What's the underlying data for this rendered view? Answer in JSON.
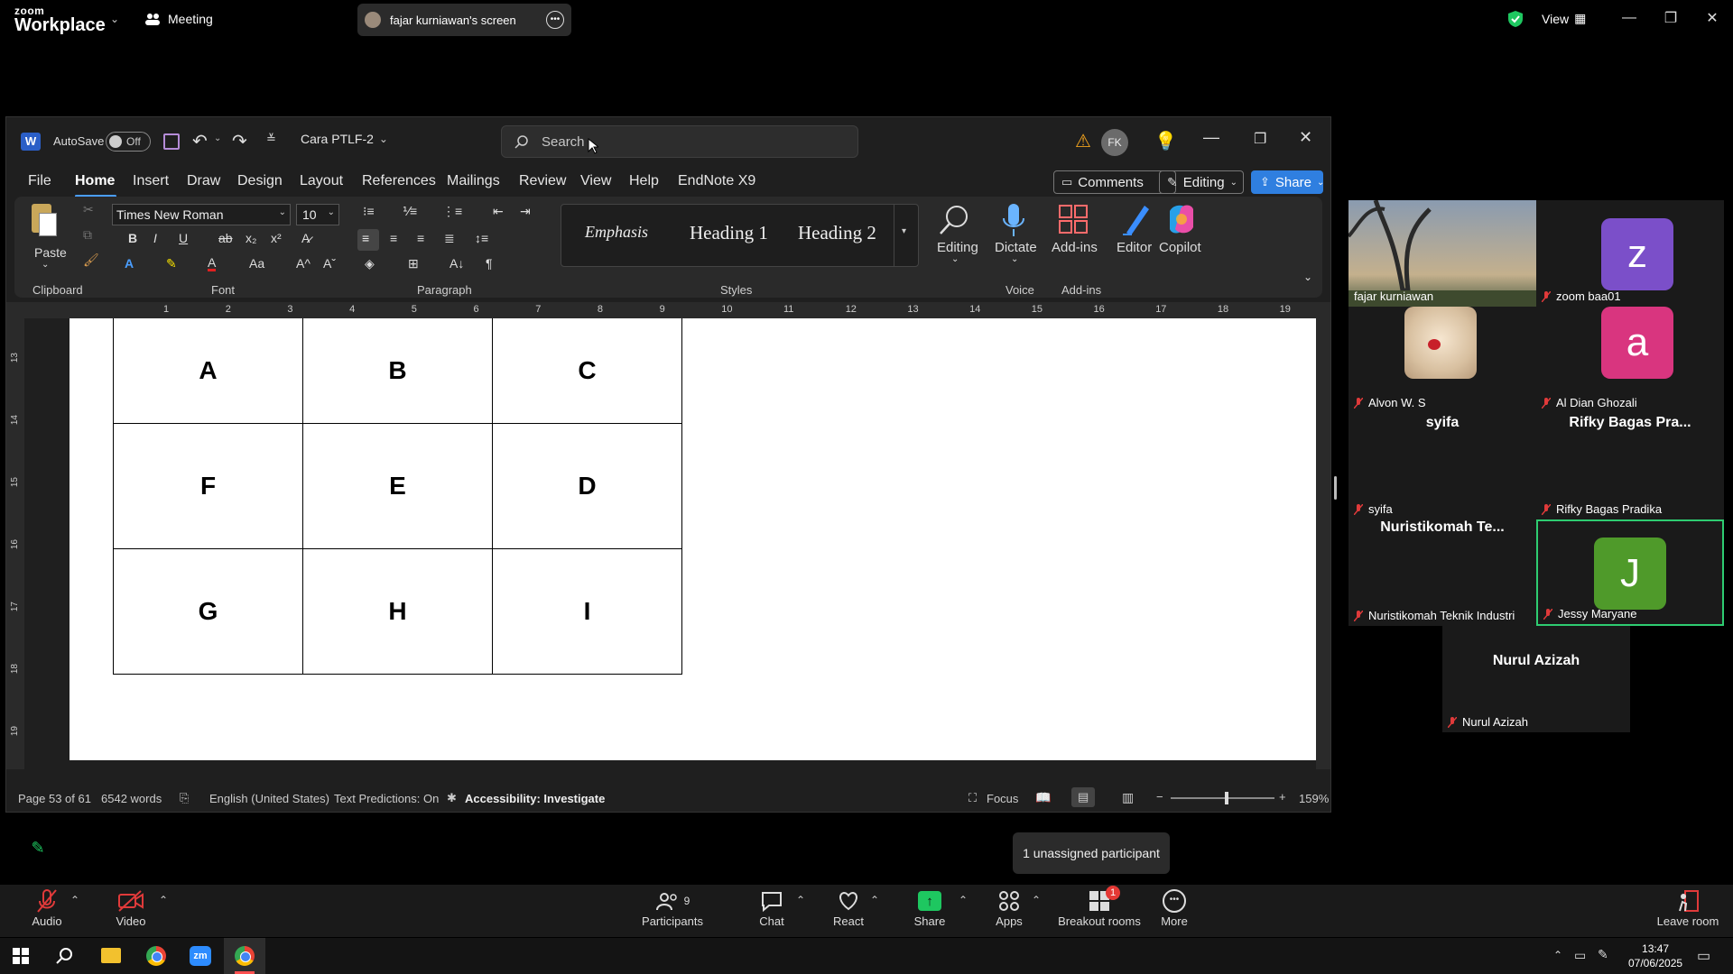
{
  "zoom": {
    "brand_line1": "zoom",
    "brand_line2": "Workplace",
    "meeting_label": "Meeting",
    "share_banner": "fajar kurniawan's screen",
    "view_label": "View",
    "unassigned_tooltip": "1 unassigned participant",
    "toolbar": {
      "audio": "Audio",
      "video": "Video",
      "participants": "Participants",
      "participants_count": "9",
      "chat": "Chat",
      "react": "React",
      "share": "Share",
      "apps": "Apps",
      "breakout": "Breakout rooms",
      "breakout_badge": "1",
      "more": "More",
      "leave": "Leave room"
    }
  },
  "word": {
    "autosave_label": "AutoSave",
    "autosave_state": "Off",
    "doc_title": "Cara PTLF-2",
    "search_placeholder": "Search",
    "user_initials": "FK",
    "menu": [
      "File",
      "Home",
      "Insert",
      "Draw",
      "Design",
      "Layout",
      "References",
      "Mailings",
      "Review",
      "View",
      "Help",
      "EndNote X9"
    ],
    "comments_btn": "Comments",
    "editing_btn": "Editing",
    "share_btn": "Share",
    "ribbon": {
      "paste": "Paste",
      "font_name": "Times New Roman",
      "font_size": "10",
      "styles": [
        "Emphasis",
        "Heading 1",
        "Heading 2"
      ],
      "editing": "Editing",
      "dictate": "Dictate",
      "addins": "Add-ins",
      "editor": "Editor",
      "copilot": "Copilot",
      "groups": [
        "Clipboard",
        "Font",
        "Paragraph",
        "Styles",
        "Voice",
        "Add-ins"
      ]
    },
    "ruler_numbers": [
      "1",
      "2",
      "3",
      "4",
      "5",
      "6",
      "7",
      "8",
      "9",
      "10",
      "11",
      "12",
      "13",
      "14",
      "15",
      "16",
      "17",
      "18",
      "19"
    ],
    "vruler_numbers": [
      "13",
      "14",
      "15",
      "16",
      "17",
      "18",
      "19"
    ],
    "table": [
      [
        "A",
        "B",
        "C"
      ],
      [
        "F",
        "E",
        "D"
      ],
      [
        "G",
        "H",
        "I"
      ]
    ],
    "status": {
      "page": "Page 53 of 61",
      "words": "6542 words",
      "language": "English (United States)",
      "predictions": "Text Predictions: On",
      "accessibility": "Accessibility: Investigate",
      "focus": "Focus",
      "zoom": "159%"
    }
  },
  "participants": [
    {
      "name": "fajar kurniawan",
      "type": "video"
    },
    {
      "name": "zoom baa01",
      "initial": "z",
      "color": "#7b4fc9"
    },
    {
      "name": "Alvon W. S",
      "type": "photo"
    },
    {
      "name": "Al Dian Ghozali",
      "initial": "a",
      "color": "#d9357f"
    },
    {
      "name": "syifa",
      "big": "syifa"
    },
    {
      "name": "Rifky Bagas Pradika",
      "big": "Rifky Bagas Pra..."
    },
    {
      "name": "Nuristikomah Teknik Industri",
      "big": "Nuristikomah Te..."
    },
    {
      "name": "Jessy Maryane",
      "initial": "J",
      "color": "#4f9a2a"
    },
    {
      "name": "Nurul Azizah",
      "big": "Nurul Azizah"
    }
  ],
  "taskbar": {
    "time": "13:47",
    "date": "07/06/2025"
  }
}
